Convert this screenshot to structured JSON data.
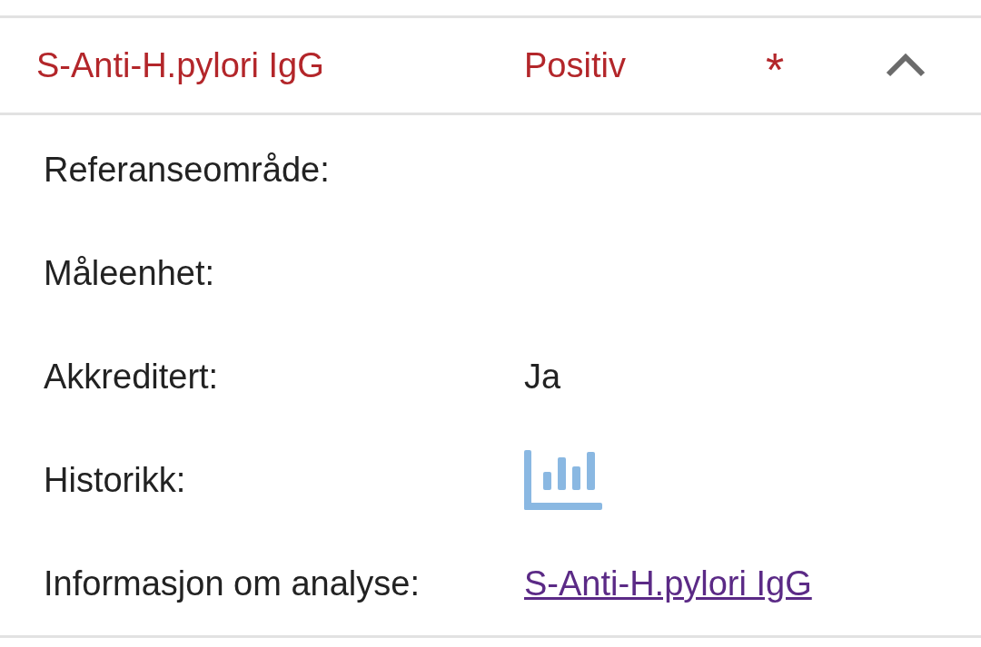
{
  "result": {
    "name": "S-Anti-H.pylori IgG",
    "value": "Positiv",
    "flag": "*",
    "expanded": true
  },
  "details": [
    {
      "kind": "text",
      "label": "Referanseområde:"
    },
    {
      "kind": "text",
      "label": "Måleenhet:"
    },
    {
      "kind": "text",
      "label": "Akkreditert:",
      "value": "Ja"
    },
    {
      "kind": "chart",
      "label": "Historikk:"
    },
    {
      "kind": "link",
      "label": "Informasjon om analyse:",
      "value": "S-Anti-H.pylori IgG"
    }
  ]
}
